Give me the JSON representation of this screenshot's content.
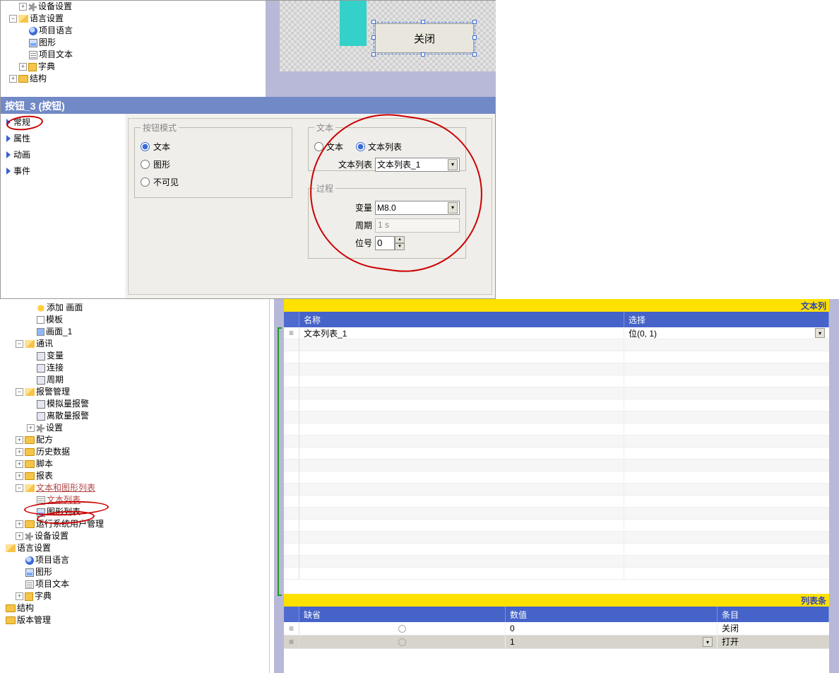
{
  "top_tree": {
    "it0": "设备设置",
    "lang": "语言设置",
    "proj_lang": "项目语言",
    "graphics": "图形",
    "proj_text": "项目文本",
    "dict": "字典",
    "struct": "结构"
  },
  "canvas": {
    "close_label": "关闭"
  },
  "props": {
    "title": "按钮_3 (按钮)",
    "nav": {
      "general": "常规",
      "attr": "属性",
      "anim": "动画",
      "event": "事件"
    },
    "mode": {
      "legend": "按钮模式",
      "text": "文本",
      "graphic": "图形",
      "invisible": "不可见"
    },
    "text": {
      "legend": "文本",
      "radio_text": "文本",
      "radio_list": "文本列表",
      "list_label": "文本列表",
      "list_value": "文本列表_1"
    },
    "proc": {
      "legend": "过程",
      "var_label": "变量",
      "var_value": "M8.0",
      "cycle_label": "周期",
      "cycle_value": "1 s",
      "bit_label": "位号",
      "bit_value": "0"
    }
  },
  "btm_tree": {
    "add_screen": "添加 画面",
    "template": "模板",
    "screen1": "画面_1",
    "comm": "通讯",
    "vars": "变量",
    "conns": "连接",
    "cycles": "周期",
    "alarm": "报警管理",
    "analog": "模拟量报警",
    "discrete": "离散量报警",
    "settings": "设置",
    "recipe": "配方",
    "history": "历史数据",
    "script": "脚本",
    "report": "报表",
    "txtgfx": "文本和图形列表",
    "txtlist": "文本列表",
    "gfxlist": "图形列表",
    "runtime": "运行系统用户管理",
    "device": "设备设置",
    "lang": "语言设置",
    "proj_lang": "项目语言",
    "graphics": "图形",
    "proj_text": "项目文本",
    "dict": "字典",
    "struct": "结构",
    "version": "版本管理"
  },
  "txtlist_panel": {
    "title_right": "文本列",
    "hdr_name": "名称",
    "hdr_select": "选择",
    "row1_name": "文本列表_1",
    "row1_select": "位(0, 1)"
  },
  "entries_panel": {
    "title_right": "列表条",
    "hdr_default": "缺省",
    "hdr_value": "数值",
    "hdr_entry": "条目",
    "r0_val": "0",
    "r0_entry": "关闭",
    "r1_val": "1",
    "r1_entry": "打开"
  }
}
